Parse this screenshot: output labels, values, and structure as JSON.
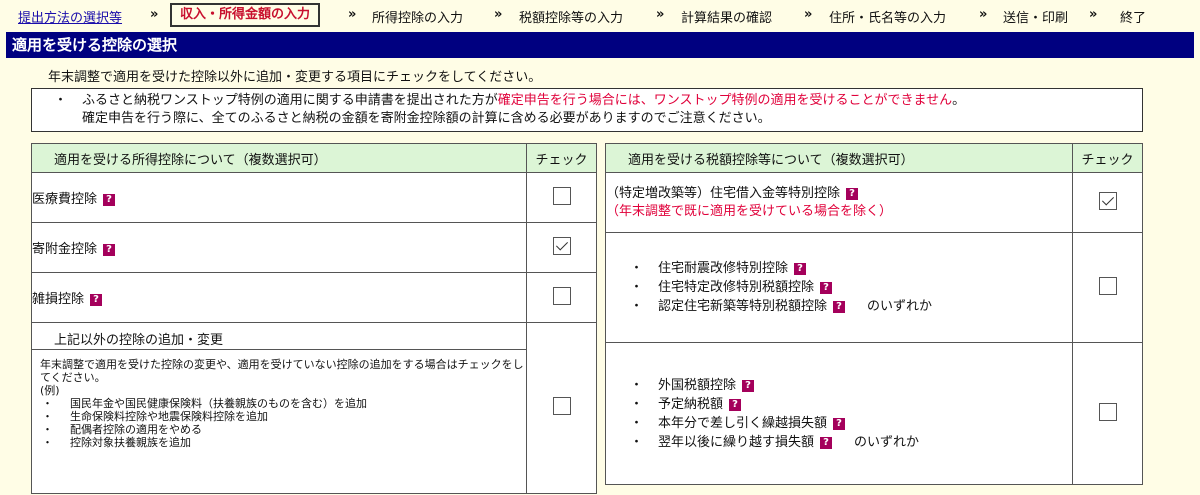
{
  "breadcrumb": {
    "steps": [
      "提出方法の選択等",
      "収入・所得金額の入力",
      "所得控除の入力",
      "税額控除等の入力",
      "計算結果の確認",
      "住所・氏名等の入力",
      "送信・印刷",
      "終了"
    ],
    "separator": "»"
  },
  "page": {
    "title": "適用を受ける控除の選択",
    "instruction": "年末調整で適用を受けた控除以外に追加・変更する項目にチェックをしてください。"
  },
  "notice": {
    "bullet": "・",
    "line1_normal": "ふるさと納税ワンストップ特例の適用に関する申請書を提出された方が",
    "line1_red": "確定申告を行う場合には、ワンストップ特例の適用を受けることができません",
    "line1_end": "。",
    "line2": "確定申告を行う際に、全てのふるさと納税の金額を寄附金控除額の計算に含める必要がありますのでご注意ください。"
  },
  "help_icon": "?",
  "left_table": {
    "header": "適用を受ける所得控除について（複数選択可）",
    "check_header": "チェック",
    "rows": [
      {
        "label": "医療費控除",
        "checked": false
      },
      {
        "label": "寄附金控除",
        "checked": true
      },
      {
        "label": "雑損控除",
        "checked": false
      }
    ],
    "other": {
      "title": "上記以外の控除の追加・変更",
      "desc": "年末調整で適用を受けた控除の変更や、適用を受けていない控除の追加をする場合はチェックをしてください。",
      "example_label": "(例)",
      "examples": [
        "国民年金や国民健康保険料（扶養親族のものを含む）を追加",
        "生命保険料控除や地震保険料控除を追加",
        "配偶者控除の適用をやめる",
        "控除対象扶養親族を追加"
      ],
      "checked": false
    }
  },
  "right_table": {
    "header": "適用を受ける税額控除等について（複数選択可）",
    "check_header": "チェック",
    "housing": {
      "label": "（特定増改築等）住宅借入金等特別控除",
      "note": "（年末調整で既に適用を受けている場合を除く）",
      "checked": true
    },
    "group1": {
      "items": [
        "住宅耐震改修特別控除",
        "住宅特定改修特別税額控除",
        "認定住宅新築等特別税額控除"
      ],
      "suffix": "のいずれか",
      "checked": false
    },
    "group2": {
      "items": [
        "外国税額控除",
        "予定納税額",
        "本年分で差し引く繰越損失額",
        "翌年以後に繰り越す損失額"
      ],
      "suffix": "のいずれか",
      "checked": false
    }
  },
  "colors": {
    "title_bar": "#000080",
    "header_bg": "#dcf5d6",
    "accent_red": "#e0003a",
    "help_icon": "#a4005b",
    "page_bg": "#fffde6"
  }
}
